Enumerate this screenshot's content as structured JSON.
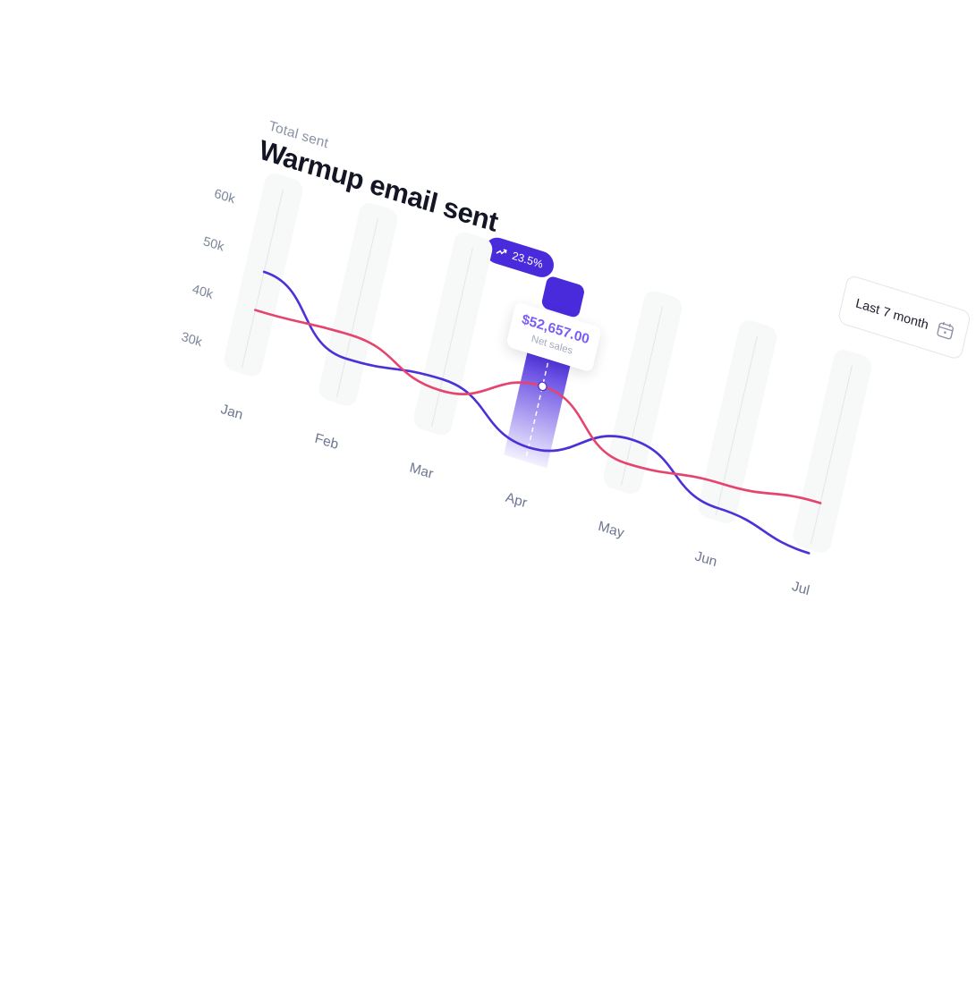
{
  "header": {
    "subtitle": "Total sent",
    "title": "Warmup email sent",
    "badge": {
      "icon": "trend-up-icon",
      "value": "23.5%"
    }
  },
  "filter": {
    "label": "Last 7 month",
    "icon": "calendar-icon"
  },
  "tooltip": {
    "value": "$52,657.00",
    "label": "Net sales",
    "month": "Apr"
  },
  "colors": {
    "accent": "#4a2bdc",
    "series_blue": "#4b32d8",
    "series_red": "#e5446d",
    "column_bg": "#f7f8f8"
  },
  "chart_data": {
    "type": "line",
    "categories": [
      "Jan",
      "Feb",
      "Mar",
      "Apr",
      "May",
      "Jun",
      "Jul"
    ],
    "yticks": [
      "60k",
      "50k",
      "40k",
      "30k"
    ],
    "ylim": [
      30000,
      60000
    ],
    "highlight": "Apr",
    "series": [
      {
        "values": [
          39500,
          40400,
          35000,
          42000,
          32000,
          33800,
          36000
        ]
      },
      {
        "values": [
          47500,
          35500,
          37300,
          29200,
          37000,
          28800,
          25500
        ]
      }
    ]
  }
}
